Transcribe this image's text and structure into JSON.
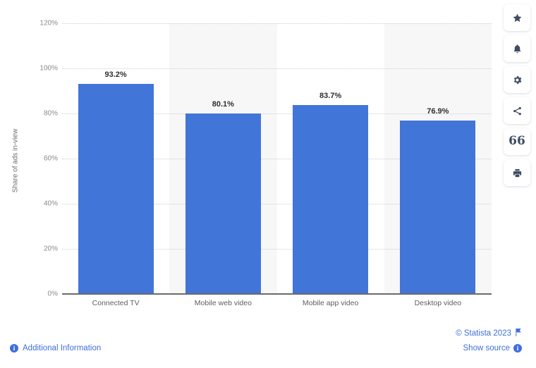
{
  "chart_data": {
    "type": "bar",
    "title": "",
    "subtitle": "",
    "xlabel": "",
    "ylabel": "Share of ads in-view",
    "ylim": [
      0,
      120
    ],
    "ytick_labels": [
      "120%",
      "100%",
      "80%",
      "60%",
      "40%",
      "20%",
      "0%"
    ],
    "ytick_values": [
      120,
      100,
      80,
      60,
      40,
      20,
      0
    ],
    "grid": true,
    "legend": "none",
    "bar_color": "#4175d8",
    "band_color": "#f7f7f7",
    "categories": [
      "Connected TV",
      "Mobile web video",
      "Mobile app video",
      "Desktop video"
    ],
    "values": [
      93.2,
      80.1,
      83.7,
      76.9
    ],
    "value_labels": [
      "93.2%",
      "80.1%",
      "83.7%",
      "76.9%"
    ]
  },
  "toolbar": {
    "buttons": [
      {
        "name": "favorite",
        "icon": "star-icon"
      },
      {
        "name": "notify",
        "icon": "bell-icon"
      },
      {
        "name": "settings",
        "icon": "gear-icon"
      },
      {
        "name": "share",
        "icon": "share-icon"
      },
      {
        "name": "cite",
        "icon": "quote-icon",
        "glyph": "66"
      },
      {
        "name": "print",
        "icon": "print-icon"
      }
    ]
  },
  "footer": {
    "copyright": "© Statista 2023",
    "show_source": "Show source",
    "additional_information": "Additional Information",
    "info_glyph": "i",
    "link_color": "#3f6fdd"
  }
}
